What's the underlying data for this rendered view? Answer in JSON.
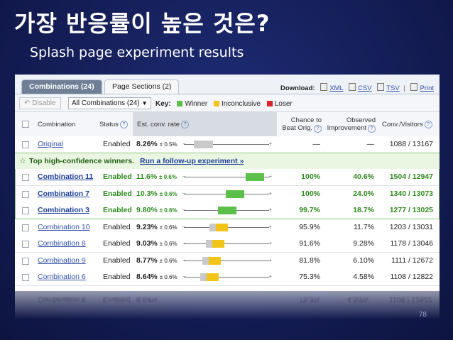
{
  "slide": {
    "title": "가장 반응률이 높은 것은?",
    "subtitle": "Splash page experiment results",
    "page_number": "78"
  },
  "tabs": [
    {
      "label": "Combinations (24)",
      "active": true
    },
    {
      "label": "Page Sections (2)",
      "active": false
    }
  ],
  "download": {
    "label": "Download:",
    "xml": "XML",
    "csv": "CSV",
    "tsv": "TSV",
    "separator": "|",
    "print": "Print"
  },
  "toolbar": {
    "disable_label": "Disable",
    "filter_value": "All Combinations (24)",
    "key_label": "Key:",
    "key_winner": "Winner",
    "key_inconclusive": "Inconclusive",
    "key_loser": "Loser"
  },
  "headers": {
    "combination": "Combination",
    "status": "Status",
    "rate": "Est. conv. rate",
    "chance_1": "Chance to",
    "chance_2": "Beat Orig.",
    "improvement_1": "Observed",
    "improvement_2": "Improvement",
    "conv": "Conv./Visitors"
  },
  "colors": {
    "winner": "#5cbf4a",
    "inconclusive": "#f3c418",
    "loser": "#d8262a",
    "gray": "#c9c9c9"
  },
  "original": {
    "name": "Original",
    "status": "Enabled",
    "rate": "8.26%",
    "ci": "± 0.5%",
    "chance": "—",
    "improvement": "—",
    "conv": "1088 / 13167"
  },
  "banner": {
    "title": "Top high-confidence winners.",
    "link": "Run a follow-up experiment »"
  },
  "rows": [
    {
      "name": "Combination 11",
      "status": "Enabled",
      "rate": "11.6%",
      "ci": "± 0.6%",
      "chance": "100%",
      "improvement": "40.6%",
      "conv": "1504 / 12947",
      "winner": true
    },
    {
      "name": "Combination 7",
      "status": "Enabled",
      "rate": "10.3%",
      "ci": "± 0.6%",
      "chance": "100%",
      "improvement": "24.0%",
      "conv": "1340 / 13073",
      "winner": true
    },
    {
      "name": "Combination 3",
      "status": "Enabled",
      "rate": "9.80%",
      "ci": "± 0.6%",
      "chance": "99.7%",
      "improvement": "18.7%",
      "conv": "1277 / 13025",
      "winner": true
    },
    {
      "name": "Combination 10",
      "status": "Enabled",
      "rate": "9.23%",
      "ci": "± 0.6%",
      "chance": "95.9%",
      "improvement": "11.7%",
      "conv": "1203 / 13031",
      "winner": false
    },
    {
      "name": "Combination 8",
      "status": "Enabled",
      "rate": "9.03%",
      "ci": "± 0.6%",
      "chance": "91.6%",
      "improvement": "9.28%",
      "conv": "1178 / 13046",
      "winner": false
    },
    {
      "name": "Combination 9",
      "status": "Enabled",
      "rate": "8.77%",
      "ci": "± 0.6%",
      "chance": "81.8%",
      "improvement": "6.10%",
      "conv": "1111 / 12672",
      "winner": false
    },
    {
      "name": "Combination 6",
      "status": "Enabled",
      "rate": "8.64%",
      "ci": "± 0.6%",
      "chance": "75.3%",
      "improvement": "4.58%",
      "conv": "1108 / 12822",
      "winner": false
    }
  ],
  "rate_axis": {
    "min": 7.0,
    "max": 12.5
  }
}
